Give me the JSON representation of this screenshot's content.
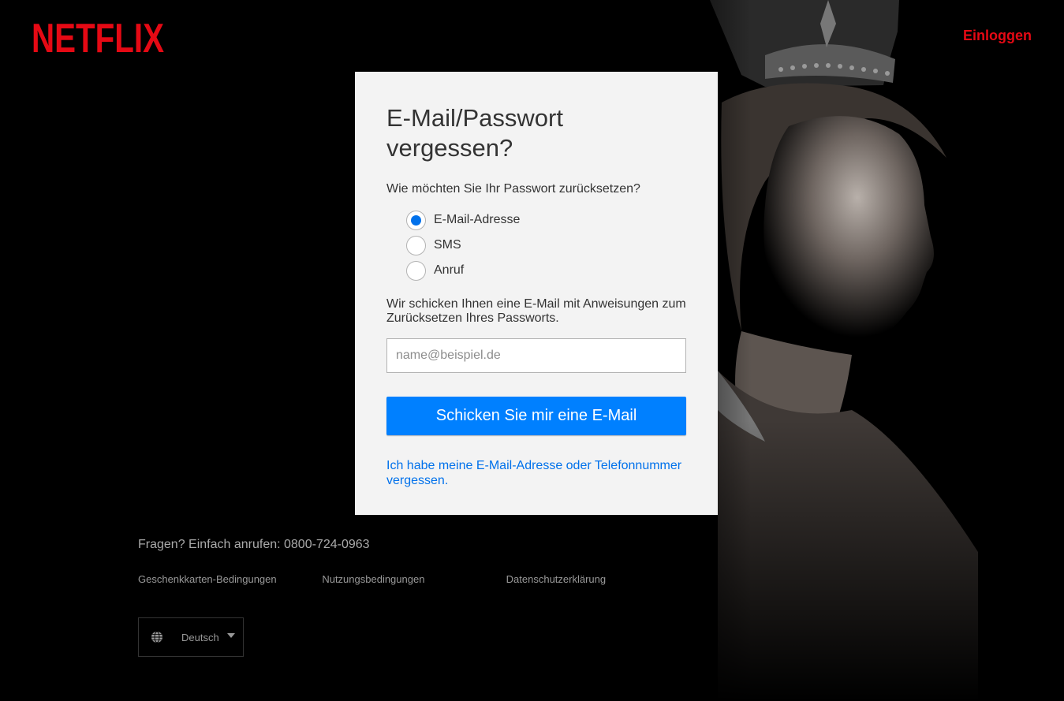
{
  "header": {
    "logo_text": "NETFLIX",
    "signin_label": "Einloggen"
  },
  "card": {
    "title": "E-Mail/Passwort vergessen?",
    "question": "Wie möchten Sie Ihr Passwort zurücksetzen?",
    "options": [
      {
        "label": "E-Mail-Adresse",
        "checked": true
      },
      {
        "label": "SMS",
        "checked": false
      },
      {
        "label": "Anruf",
        "checked": false
      }
    ],
    "info": "Wir schicken Ihnen eine E-Mail mit Anweisungen zum Zurücksetzen Ihres Passworts.",
    "email_placeholder": "name@beispiel.de",
    "email_value": "",
    "submit_label": "Schicken Sie mir eine E-Mail",
    "forgot_link": "Ich habe meine E-Mail-Adresse oder Telefonnummer vergessen."
  },
  "footer": {
    "phone_text": "Fragen? Einfach anrufen: 0800-724-0963",
    "links": [
      "Geschenkkarten-Bedingungen",
      "Nutzungsbedingungen",
      "Datenschutzerklärung"
    ],
    "language": "Deutsch",
    "language_icon": "globe-icon"
  },
  "colors": {
    "brand_red": "#e50914",
    "button_blue": "#0080ff",
    "link_blue": "#0071eb",
    "card_bg": "#f3f3f3",
    "page_bg": "#000000"
  }
}
